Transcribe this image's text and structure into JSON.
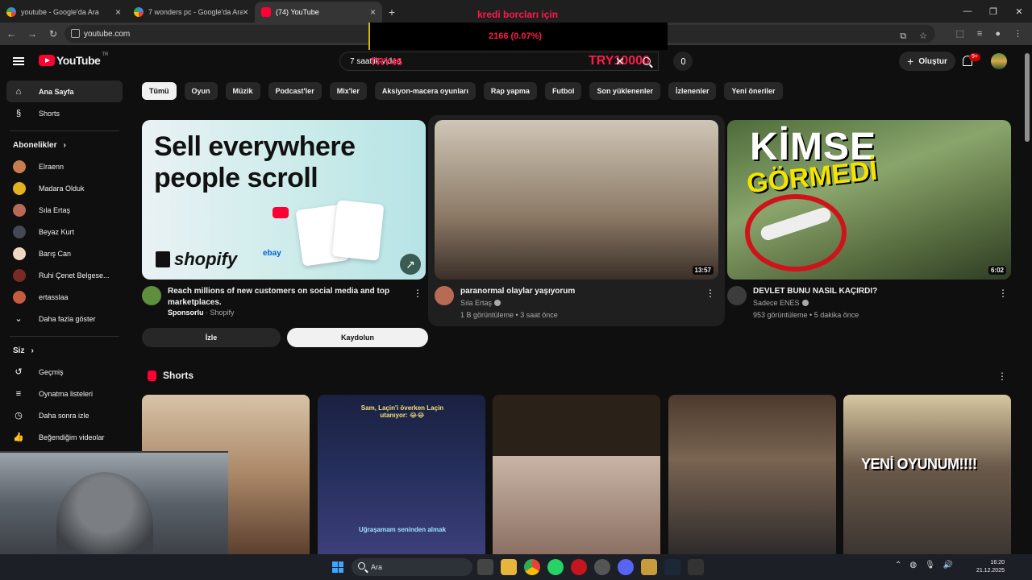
{
  "browser": {
    "tabs": [
      {
        "title": "youtube - Google'da Ara",
        "icon": "google-icon"
      },
      {
        "title": "7 wonders pc - Google'da Ara",
        "icon": "google-icon"
      },
      {
        "title": "(74) YouTube",
        "icon": "youtube-icon"
      }
    ],
    "new_tab": "+",
    "url": "youtube.com"
  },
  "stream_overlay": {
    "title": "kredi borcları için",
    "value": "2166 (0.07%)",
    "try_left": "TRY46",
    "try_right": "TRY10000"
  },
  "header": {
    "logo": "YouTube",
    "region": "TR",
    "search_value": "7 saatlik video",
    "create_label": "Oluştur",
    "notif_count": "9+"
  },
  "sidebar": {
    "main": [
      {
        "label": "Ana Sayfa",
        "icon": "home-icon"
      },
      {
        "label": "Shorts",
        "icon": "shorts-icon"
      }
    ],
    "subs_title": "Abonelikler",
    "subs": [
      {
        "label": "Elraenn",
        "color": "#c97d4f"
      },
      {
        "label": "Madara Olduk",
        "color": "#e2b21c"
      },
      {
        "label": "Sıla Ertaş",
        "color": "#b86a55"
      },
      {
        "label": "Beyaz Kurt",
        "color": "#444a55"
      },
      {
        "label": "Barış Can",
        "color": "#f0d9c2"
      },
      {
        "label": "Ruhi Çenet Belgese...",
        "color": "#7a2a25"
      },
      {
        "label": "ertasslaa",
        "color": "#c55c3e"
      }
    ],
    "show_more": "Daha fazla göster",
    "you_title": "Siz",
    "you": [
      {
        "label": "Geçmiş",
        "icon": "history-icon"
      },
      {
        "label": "Oynatma listeleri",
        "icon": "playlist-icon"
      },
      {
        "label": "Daha sonra izle",
        "icon": "clock-icon"
      },
      {
        "label": "Beğendiğim videolar",
        "icon": "like-icon"
      }
    ]
  },
  "chips": [
    "Tümü",
    "Oyun",
    "Müzik",
    "Podcast'ler",
    "Mix'ler",
    "Aksiyon-macera oyunları",
    "Rap yapma",
    "Futbol",
    "Son yüklenenler",
    "İzlenenler",
    "Yeni öneriler"
  ],
  "ad": {
    "headline_1": "Sell everywhere",
    "headline_2": "people scroll",
    "brand": "shopify",
    "ebay": "ebay",
    "title": "Reach millions of new customers on social media and top marketplaces.",
    "sponsored": "Sponsorlu",
    "advertiser": "Shopify",
    "watch_label": "İzle",
    "subscribe_label": "Kaydolun"
  },
  "videos": [
    {
      "title": "paranormal olaylar yaşıyorum",
      "channel": "Sıla Ertaş",
      "stats": "1 B görüntüleme • 3 saat önce",
      "duration": "13:57"
    },
    {
      "title": "DEVLET BUNU NASIL KAÇIRDI?",
      "channel": "Sadece ENES",
      "stats": "953 görüntüleme • 5 dakika önce",
      "duration": "6:02",
      "thumb_line1": "KİMSE",
      "thumb_line2": "GÖRMEDİ"
    }
  ],
  "shorts": {
    "title": "Shorts",
    "items": [
      {
        "caption": ""
      },
      {
        "caption": "Sam, Laçin'i överken Laçin utanıyor: 😂😂",
        "caption2": "Uğraşamam seninden almak"
      },
      {
        "caption": ""
      },
      {
        "caption": ""
      },
      {
        "caption": "YENİ OYUNUM!!!!"
      }
    ]
  },
  "taskbar": {
    "search": "Ara",
    "time": "16:20",
    "date": "21.12.2025"
  }
}
